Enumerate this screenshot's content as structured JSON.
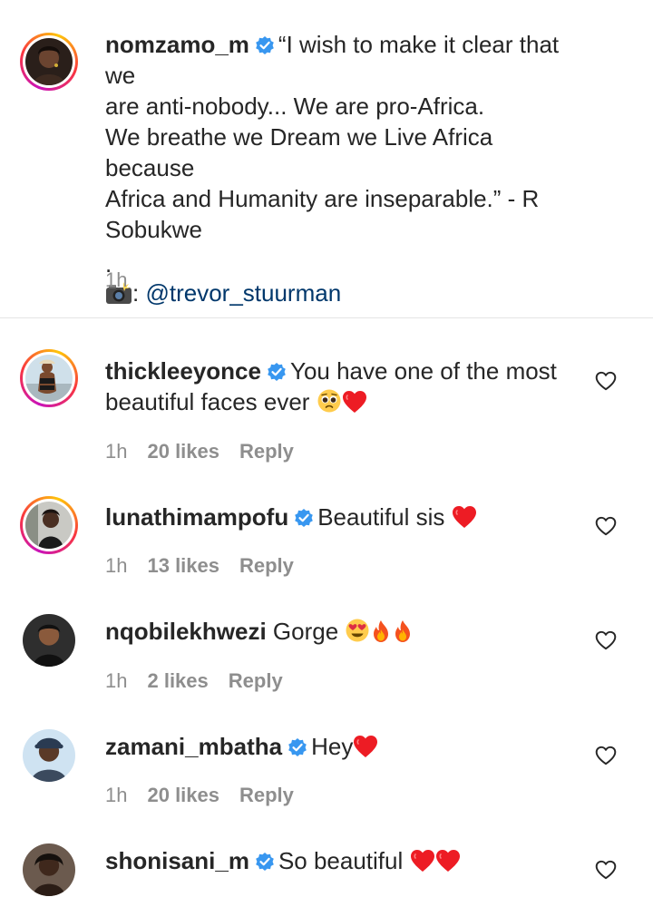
{
  "post": {
    "username": "nomzamo_m",
    "caption_line1": "“I wish to make it clear that we",
    "caption_line2": "are anti-nobody... We are pro-Africa.",
    "caption_line3": "We breathe we Dream we Live Africa because",
    "caption_line4": "Africa and Humanity are inseparable.” - R",
    "caption_line5": "Sobukwe",
    "caption_dot": ".",
    "credit_prefix": ":",
    "credit_mention": "@trevor_stuurman",
    "time": "1h"
  },
  "comments": [
    {
      "username": "thickleeyonce",
      "text_line1": "You have one of the most",
      "text_line2": "beautiful faces ever",
      "time": "1h",
      "likes": "20 likes",
      "reply": "Reply"
    },
    {
      "username": "lunathimampofu",
      "text": "Beautiful sis",
      "time": "1h",
      "likes": "13 likes",
      "reply": "Reply"
    },
    {
      "username": "nqobilekhwezi",
      "text": "Gorge",
      "time": "1h",
      "likes": "2 likes",
      "reply": "Reply"
    },
    {
      "username": "zamani_mbatha",
      "text": "Hey",
      "time": "1h",
      "likes": "20 likes",
      "reply": "Reply"
    },
    {
      "username": "shonisani_m",
      "text": "So beautiful"
    }
  ],
  "icons": {
    "verified": "verified-badge-icon",
    "like": "heart-outline-icon",
    "camera": "camera-flash-icon"
  },
  "colors": {
    "verified": "#3897f0",
    "heart": "#ed1c24",
    "muted": "#8e8e8e",
    "mention": "#00376b"
  }
}
